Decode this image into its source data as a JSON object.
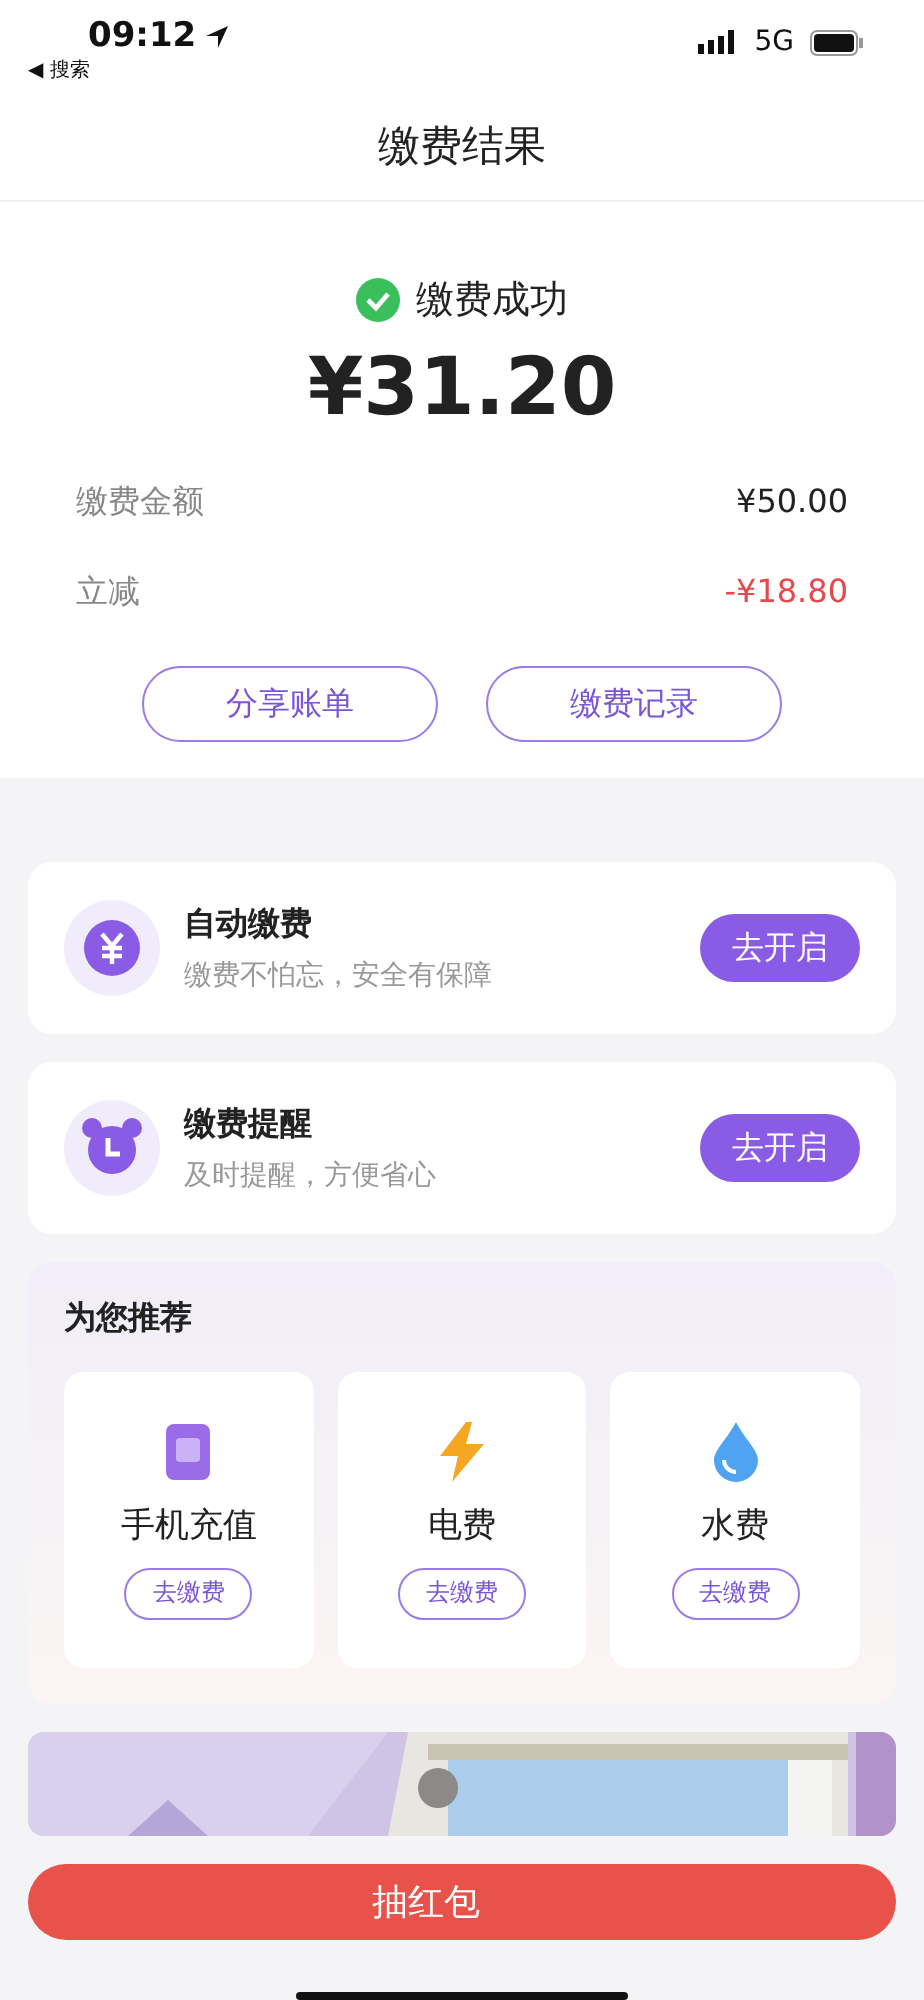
{
  "status_bar": {
    "time": "09:12",
    "back_label": "◀ 搜索",
    "network": "5G"
  },
  "nav": {
    "title": "缴费结果"
  },
  "result": {
    "status": "缴费成功",
    "amount": "¥31.20",
    "details": [
      {
        "label": "缴费金额",
        "value": "¥50.00",
        "kind": "normal"
      },
      {
        "label": "立减",
        "value": "-¥18.80",
        "kind": "discount"
      }
    ],
    "buttons": [
      "分享账单",
      "缴费记录"
    ]
  },
  "services": [
    {
      "kind": "yuan",
      "title": "自动缴费",
      "subtitle": "缴费不怕忘，安全有保障",
      "button": "去开启"
    },
    {
      "kind": "clock",
      "title": "缴费提醒",
      "subtitle": "及时提醒，方便省心",
      "button": "去开启"
    }
  ],
  "recommend": {
    "title": "为您推荐",
    "items": [
      {
        "kind": "phone",
        "name": "手机充值",
        "button": "去缴费"
      },
      {
        "kind": "bolt",
        "name": "电费",
        "button": "去缴费"
      },
      {
        "kind": "drop",
        "name": "水费",
        "button": "去缴费"
      }
    ]
  },
  "action_button": "抽红包"
}
